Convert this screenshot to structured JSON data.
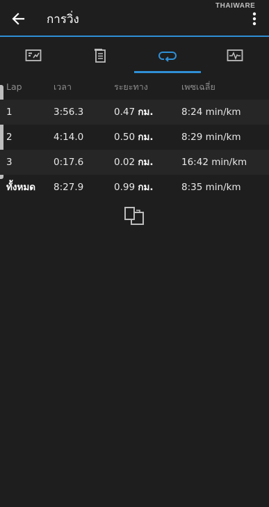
{
  "appbar": {
    "title": "การวิ่ง",
    "back_icon": "arrow-left-icon",
    "menu_icon": "more-vertical-icon"
  },
  "watermark": "THAIWARE",
  "tabs": [
    {
      "icon": "summary-chart-icon",
      "active": false
    },
    {
      "icon": "details-document-icon",
      "active": false
    },
    {
      "icon": "laps-loop-icon",
      "active": true
    },
    {
      "icon": "activity-graph-icon",
      "active": false
    }
  ],
  "laps_table": {
    "headers": [
      "Lap",
      "เวลา",
      "ระยะทาง",
      "เพซเฉลี่ย"
    ],
    "rows": [
      {
        "lap": "1",
        "time": "3:56.3",
        "distance": "0.47",
        "unit": "กม.",
        "pace": "8:24 min/km"
      },
      {
        "lap": "2",
        "time": "4:14.0",
        "distance": "0.50",
        "unit": "กม.",
        "pace": "8:29 min/km"
      },
      {
        "lap": "3",
        "time": "0:17.6",
        "distance": "0.02",
        "unit": "กม.",
        "pace": "16:42 min/km"
      }
    ],
    "total": {
      "lap": "ทั้งหมด",
      "time": "8:27.9",
      "distance": "0.99",
      "unit": "กม.",
      "pace": "8:35 min/km"
    }
  },
  "colors": {
    "accent": "#2f8fd6",
    "background": "#1e1e1e"
  }
}
